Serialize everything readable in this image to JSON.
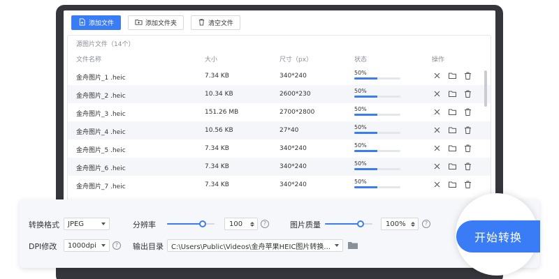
{
  "toolbar": {
    "add_file": "添加文件",
    "add_folder": "添加文件夹",
    "clear_files": "清空文件"
  },
  "panel": {
    "title": "源图片文件（14个）",
    "columns": {
      "name": "文件名称",
      "size": "大小",
      "dimensions": "尺寸（px）",
      "status": "状态",
      "actions": "操作"
    }
  },
  "files": [
    {
      "name": "金舟图片_1 .heic",
      "size": "7.34 KB",
      "dimensions": "340*240",
      "progress": "50%"
    },
    {
      "name": "金舟图片_2 .heic",
      "size": "10.34 KB",
      "dimensions": "2600*230",
      "progress": "50%"
    },
    {
      "name": "金舟图片_3 .heic",
      "size": "151.26 MB",
      "dimensions": "2700*2800",
      "progress": "50%"
    },
    {
      "name": "金舟图片_4 .heic",
      "size": "10.56 KB",
      "dimensions": "27*40",
      "progress": "50%"
    },
    {
      "name": "金舟图片_5 .heic",
      "size": "7.34 KB",
      "dimensions": "340*240",
      "progress": "50%"
    },
    {
      "name": "金舟图片_6 .heic",
      "size": "7.34 KB",
      "dimensions": "340*240",
      "progress": "50%"
    },
    {
      "name": "金舟图片_7 .heic",
      "size": "7.34 KB",
      "dimensions": "340*240",
      "progress": "50%"
    }
  ],
  "settings": {
    "format_label": "转换格式",
    "format_value": "JPEG",
    "resolution_label": "分辨率",
    "resolution_value": "100",
    "resolution_level": 0.75,
    "quality_label": "图片质量",
    "quality_value": "100%",
    "quality_level": 0.75,
    "dpi_label": "DPI修改",
    "dpi_value": "1000dpi",
    "output_label": "输出目录",
    "output_path": "C:\\Users\\Public\\Videos\\金舟苹果HEIC图片转换...",
    "help_glyph": "?"
  },
  "start_button": "开始转换",
  "colors": {
    "accent": "#3a7cf5",
    "bezel": "#34363b"
  },
  "icons": {
    "add_file": "add-file-icon",
    "add_folder": "add-folder-icon",
    "clear": "trash-icon",
    "row_remove": "close-icon",
    "row_open": "folder-icon",
    "row_delete": "trash-icon",
    "output_browse": "folder-icon"
  }
}
